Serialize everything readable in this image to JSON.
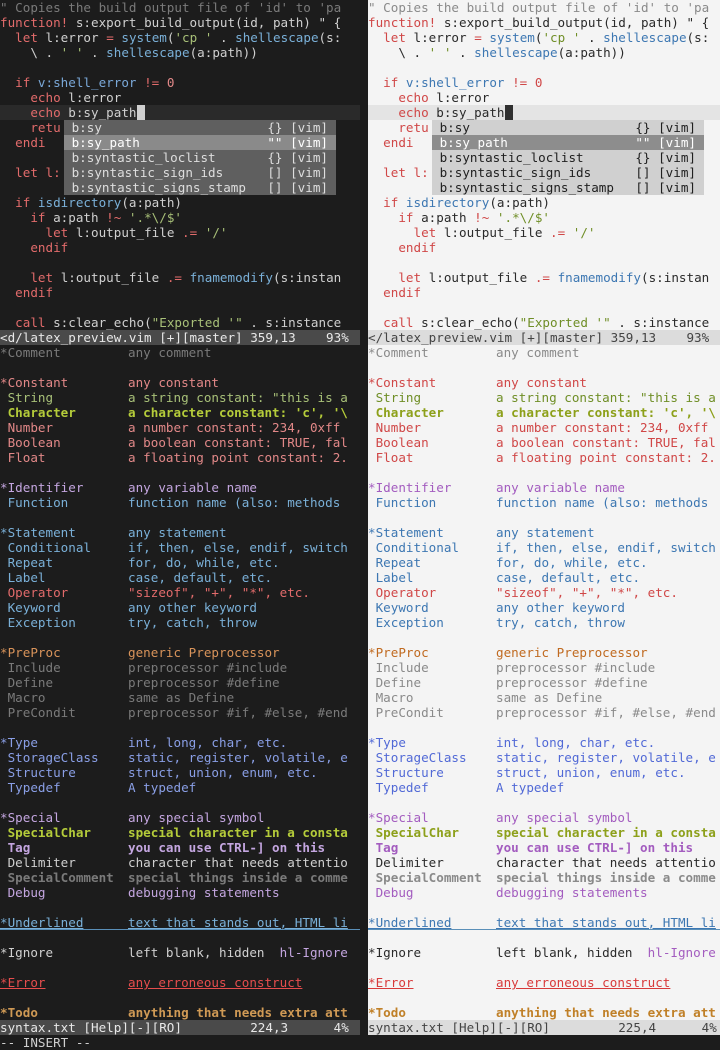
{
  "colors": {
    "dark": {
      "comment": "#7a7a7a",
      "kw": "#e26b6b",
      "fn": "#7ab0d8",
      "str": "#a8c078",
      "num": "#e28888",
      "pp": "#d8935a",
      "type": "#8a9fe6",
      "special": "#c4a6e0",
      "specbold": "#b5cc3a",
      "err": "#e64d4d",
      "todo": "#d09a55",
      "normal": "#d0d0d0",
      "var": "#7aa8d8"
    },
    "light": {
      "comment": "#8a8a8a",
      "kw": "#d04747",
      "fn": "#3d77b2",
      "str": "#6f8e26",
      "num": "#d04747",
      "pp": "#c06a20",
      "type": "#5169d6",
      "special": "#a35cbf",
      "specbold": "#8da01a",
      "err": "#d83a3a",
      "todo": "#c08028",
      "normal": "#2a2a2a",
      "var": "#3d77b2"
    }
  },
  "code_lines": [
    [
      [
        "\" Copies the build output file of 'id' to 'pa",
        "comment"
      ]
    ],
    [
      [
        "function! ",
        "kw"
      ],
      [
        "s:export_build_output",
        "normal"
      ],
      [
        "(id, path) \" {",
        "normal"
      ]
    ],
    [
      [
        "  ",
        "normal"
      ],
      [
        "let ",
        "kw"
      ],
      [
        "l:error ",
        "normal"
      ],
      [
        "= ",
        "kw"
      ],
      [
        "system",
        "fn"
      ],
      [
        "(",
        "normal"
      ],
      [
        "'cp '",
        "str"
      ],
      [
        " . ",
        "normal"
      ],
      [
        "shellescape",
        "fn"
      ],
      [
        "(s:",
        "normal"
      ]
    ],
    [
      [
        "    \\ . ",
        "normal"
      ],
      [
        "' '",
        "str"
      ],
      [
        " . ",
        "normal"
      ],
      [
        "shellescape",
        "fn"
      ],
      [
        "(a:path))",
        "normal"
      ]
    ],
    [
      [
        "",
        "normal"
      ]
    ],
    [
      [
        "  ",
        "normal"
      ],
      [
        "if ",
        "kw"
      ],
      [
        "v:shell_error ",
        "var"
      ],
      [
        "!= ",
        "kw"
      ],
      [
        "0",
        "num"
      ]
    ],
    [
      [
        "    ",
        "normal"
      ],
      [
        "echo ",
        "kw"
      ],
      [
        "l:error",
        "normal"
      ]
    ],
    [
      [
        "    ",
        "normal"
      ],
      [
        "echo ",
        "kw"
      ],
      [
        "b:sy_path",
        "normal"
      ]
    ],
    [
      [
        "    ",
        "normal"
      ],
      [
        "retu",
        "kw"
      ]
    ],
    [
      [
        "  ",
        "normal"
      ],
      [
        "endi",
        "kw"
      ]
    ],
    [
      [
        "",
        "normal"
      ]
    ],
    [
      [
        "  ",
        "normal"
      ],
      [
        "let l:",
        "kw"
      ]
    ],
    [
      [
        "",
        "normal"
      ]
    ],
    [
      [
        "  ",
        "normal"
      ],
      [
        "if ",
        "kw"
      ],
      [
        "isdirectory",
        "fn"
      ],
      [
        "(a:path)",
        "normal"
      ]
    ],
    [
      [
        "    ",
        "normal"
      ],
      [
        "if ",
        "kw"
      ],
      [
        "a:path ",
        "normal"
      ],
      [
        "!~ ",
        "kw"
      ],
      [
        "'.*\\/$'",
        "str"
      ]
    ],
    [
      [
        "      ",
        "normal"
      ],
      [
        "let ",
        "kw"
      ],
      [
        "l:output_file ",
        "normal"
      ],
      [
        ".= ",
        "kw"
      ],
      [
        "'/'",
        "str"
      ]
    ],
    [
      [
        "    ",
        "normal"
      ],
      [
        "endif",
        "kw"
      ]
    ],
    [
      [
        "",
        "normal"
      ]
    ],
    [
      [
        "    ",
        "normal"
      ],
      [
        "let ",
        "kw"
      ],
      [
        "l:output_file ",
        "normal"
      ],
      [
        ".= ",
        "kw"
      ],
      [
        "fnamemodify",
        "fn"
      ],
      [
        "(s:instan",
        "normal"
      ]
    ],
    [
      [
        "  ",
        "normal"
      ],
      [
        "endif",
        "kw"
      ]
    ],
    [
      [
        "",
        "normal"
      ]
    ],
    [
      [
        "  ",
        "normal"
      ],
      [
        "call ",
        "kw"
      ],
      [
        "s:clear_echo(",
        "normal"
      ],
      [
        "\"Exported '\"",
        "str"
      ],
      [
        " . s:instance",
        "normal"
      ]
    ]
  ],
  "popup": {
    "items": [
      {
        "word": "b:sy",
        "kind": "{} [vim]"
      },
      {
        "word": "b:sy_path",
        "kind": "\"\" [vim]"
      },
      {
        "word": "b:syntastic_loclist",
        "kind": "{} [vim]"
      },
      {
        "word": "b:syntastic_sign_ids",
        "kind": "[] [vim]"
      },
      {
        "word": "b:syntastic_signs_stamp",
        "kind": "[] [vim]"
      }
    ],
    "selected_index": 1
  },
  "status_top": {
    "dark": "<d/latex_preview.vim [+][master] 359,13    93%",
    "light": "</latex_preview.vim [+][master] 359,13    93%"
  },
  "status_bottom": {
    "dark": "syntax.txt [Help][-][RO]         224,3      4%",
    "light": "syntax.txt [Help][-][RO]         225,4      4%"
  },
  "mode": "-- INSERT --",
  "help_lines": [
    {
      "kind": "group",
      "name": "*Comment",
      "nc": "comment",
      "desc": "any comment",
      "dc": "comment"
    },
    {
      "kind": "blank"
    },
    {
      "kind": "group",
      "name": "*Constant",
      "nc": "num",
      "desc": "any constant",
      "dc": "num"
    },
    {
      "kind": "item",
      "name": " String",
      "nc": "str",
      "desc": "a string constant: \"this is a",
      "dc": "str"
    },
    {
      "kind": "item",
      "name": " Character",
      "nc": "specbold",
      "desc": "a character constant: 'c', '\\",
      "dc": "specbold",
      "bold": true
    },
    {
      "kind": "item",
      "name": " Number",
      "nc": "num",
      "desc": "a number constant: 234, 0xff",
      "dc": "num"
    },
    {
      "kind": "item",
      "name": " Boolean",
      "nc": "num",
      "desc": "a boolean constant: TRUE, fal",
      "dc": "num"
    },
    {
      "kind": "item",
      "name": " Float",
      "nc": "num",
      "desc": "a floating point constant: 2.",
      "dc": "num"
    },
    {
      "kind": "blank"
    },
    {
      "kind": "group",
      "name": "*Identifier",
      "nc": "special",
      "desc": "any variable name",
      "dc": "special"
    },
    {
      "kind": "item",
      "name": " Function",
      "nc": "fn",
      "desc": "function name (also: methods",
      "dc": "fn"
    },
    {
      "kind": "blank"
    },
    {
      "kind": "group",
      "name": "*Statement",
      "nc": "fn",
      "desc": "any statement",
      "dc": "fn"
    },
    {
      "kind": "item",
      "name": " Conditional",
      "nc": "fn",
      "desc": "if, then, else, endif, switch",
      "dc": "fn"
    },
    {
      "kind": "item",
      "name": " Repeat",
      "nc": "fn",
      "desc": "for, do, while, etc.",
      "dc": "fn"
    },
    {
      "kind": "item",
      "name": " Label",
      "nc": "fn",
      "desc": "case, default, etc.",
      "dc": "fn"
    },
    {
      "kind": "item",
      "name": " Operator",
      "nc": "kw",
      "desc": "\"sizeof\", \"+\", \"*\", etc.",
      "dc": "kw"
    },
    {
      "kind": "item",
      "name": " Keyword",
      "nc": "fn",
      "desc": "any other keyword",
      "dc": "fn"
    },
    {
      "kind": "item",
      "name": " Exception",
      "nc": "fn",
      "desc": "try, catch, throw",
      "dc": "fn"
    },
    {
      "kind": "blank"
    },
    {
      "kind": "group",
      "name": "*PreProc",
      "nc": "pp",
      "desc": "generic Preprocessor",
      "dc": "pp"
    },
    {
      "kind": "item",
      "name": " Include",
      "nc": "comment",
      "desc": "preprocessor #include",
      "dc": "comment"
    },
    {
      "kind": "item",
      "name": " Define",
      "nc": "comment",
      "desc": "preprocessor #define",
      "dc": "comment"
    },
    {
      "kind": "item",
      "name": " Macro",
      "nc": "comment",
      "desc": "same as Define",
      "dc": "comment"
    },
    {
      "kind": "item",
      "name": " PreCondit",
      "nc": "comment",
      "desc": "preprocessor #if, #else, #end",
      "dc": "comment"
    },
    {
      "kind": "blank"
    },
    {
      "kind": "group",
      "name": "*Type",
      "nc": "type",
      "desc": "int, long, char, etc.",
      "dc": "type"
    },
    {
      "kind": "item",
      "name": " StorageClass",
      "nc": "type",
      "desc": "static, register, volatile, e",
      "dc": "type"
    },
    {
      "kind": "item",
      "name": " Structure",
      "nc": "type",
      "desc": "struct, union, enum, etc.",
      "dc": "type"
    },
    {
      "kind": "item",
      "name": " Typedef",
      "nc": "type",
      "desc": "A typedef",
      "dc": "type"
    },
    {
      "kind": "blank"
    },
    {
      "kind": "group",
      "name": "*Special",
      "nc": "special",
      "desc": "any special symbol",
      "dc": "special"
    },
    {
      "kind": "item",
      "name": " SpecialChar",
      "nc": "specbold",
      "desc": "special character in a consta",
      "dc": "specbold",
      "bold": true
    },
    {
      "kind": "item",
      "name": " Tag",
      "nc": "special",
      "desc": "you can use CTRL-] on this",
      "dc": "special",
      "bold": true
    },
    {
      "kind": "item",
      "name": " Delimiter",
      "nc": "normal",
      "desc": "character that needs attentio",
      "dc": "normal"
    },
    {
      "kind": "item",
      "name": " SpecialComment",
      "nc": "comment",
      "desc": "special things inside a comme",
      "dc": "comment",
      "bold": true
    },
    {
      "kind": "item",
      "name": " Debug",
      "nc": "special",
      "desc": "debugging statements",
      "dc": "special"
    },
    {
      "kind": "blank"
    },
    {
      "kind": "group",
      "name": "*Underlined",
      "nc": "fn",
      "desc": "text that stands out, HTML li",
      "dc": "fn",
      "underline": true
    },
    {
      "kind": "blank"
    },
    {
      "kind": "group",
      "name": "*Ignore",
      "nc": "normal",
      "desc": "left blank, hidden",
      "dc": "normal",
      "extra": "  hl-Ignore"
    },
    {
      "kind": "blank"
    },
    {
      "kind": "group",
      "name": "*Error",
      "nc": "err",
      "desc": "any erroneous construct",
      "dc": "err",
      "underline": true
    },
    {
      "kind": "blank"
    },
    {
      "kind": "group",
      "name": "*Todo",
      "nc": "todo",
      "desc": "anything that needs extra att",
      "dc": "todo",
      "bold": true
    }
  ]
}
